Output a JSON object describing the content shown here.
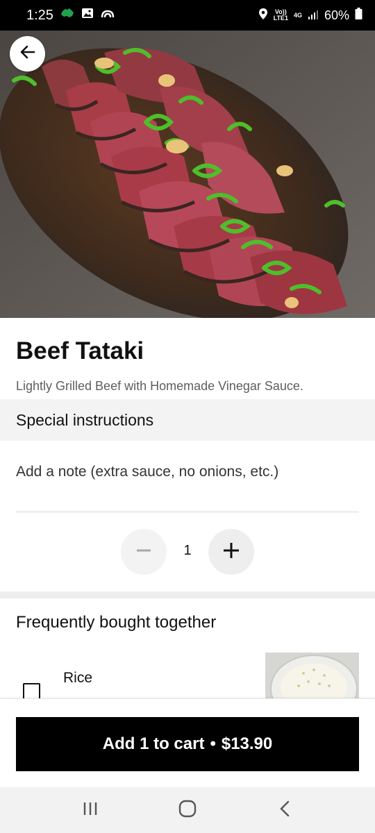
{
  "status_bar": {
    "time": "1:25",
    "carrier_label": "Vo))\nLTE1",
    "network_type": "4G",
    "battery_percent": "60%"
  },
  "item": {
    "title": "Beef Tataki",
    "description": "Lightly Grilled Beef with Homemade Vinegar Sauce."
  },
  "special_instructions": {
    "header": "Special instructions",
    "placeholder": "Add a note (extra sauce, no onions, etc.)"
  },
  "quantity": {
    "value": "1"
  },
  "frequently_bought": {
    "header": "Frequently bought together",
    "items": [
      {
        "name": "Rice",
        "checked": false
      }
    ]
  },
  "cart_button": {
    "label": "Add 1 to cart",
    "separator": "•",
    "price": "$13.90"
  },
  "colors": {
    "primary_button": "#000000",
    "section_bg": "#f3f3f3",
    "muted_text": "#5e5e5e"
  },
  "icons": {
    "back": "arrow-left-icon",
    "minus": "minus-icon",
    "plus": "plus-icon",
    "nav_recent": "recent-apps-icon",
    "nav_home": "home-icon",
    "nav_back": "back-chevron-icon"
  }
}
